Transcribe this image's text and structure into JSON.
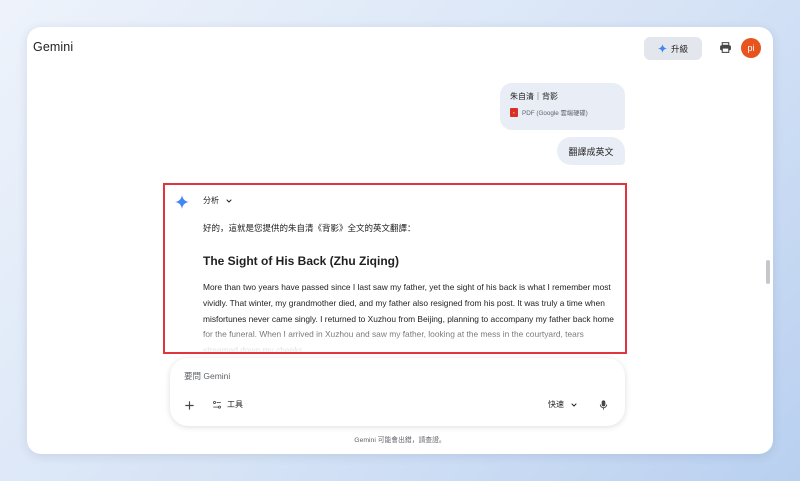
{
  "header": {
    "brand": "Gemini",
    "upgrade_label": "升級",
    "avatar_initials": "pi",
    "avatar_color": "#e8541e"
  },
  "conversation": {
    "file_attachment": {
      "name": "朱自清｜背影",
      "type_label": "PDF (Google 雲端硬碟)"
    },
    "user_message": "翻譯成英文",
    "response": {
      "model_label": "分析",
      "intro": "好的，這就是您提供的朱自清《背影》全文的英文翻譯：",
      "title": "The Sight of His Back (Zhu Ziqing)",
      "paragraph": "More than two years have passed since I last saw my father, yet the sight of his back is what I remember most vividly. That winter, my grandmother died, and my father also resigned from his post. It was truly a time when misfortunes never came singly. I returned to Xuzhou from Beijing, planning to accompany my father back home for the funeral. When I arrived in Xuzhou and saw my father, looking at the mess in the courtyard, tears streamed down my cheeks."
    }
  },
  "composer": {
    "placeholder": "要問 Gemini",
    "tools_label": "工具",
    "mode_label": "快速"
  },
  "footer": {
    "disclaimer": "Gemini 可能會出錯，請查證。"
  },
  "colors": {
    "highlight_border": "#e1343f",
    "bubble_bg": "#e9eef6",
    "gemini_blue": "#4285f4"
  }
}
